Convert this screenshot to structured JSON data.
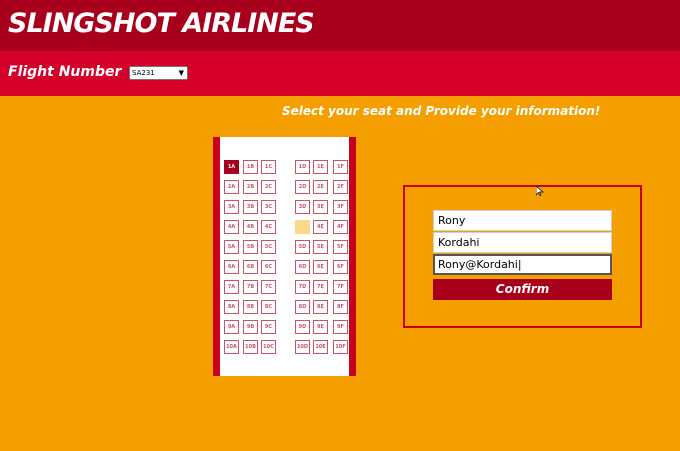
{
  "header": {
    "brand": "SLINGSHOT AIRLINES"
  },
  "flight": {
    "label": "Flight Number",
    "selected": "SA231"
  },
  "instructions": "Select your seat and Provide your information!",
  "seat_map": {
    "rows": [
      [
        "1A",
        "1B",
        "1C",
        "1D",
        "1E",
        "1F"
      ],
      [
        "2A",
        "2B",
        "2C",
        "2D",
        "2E",
        "2F"
      ],
      [
        "3A",
        "3B",
        "3C",
        "3D",
        "3E",
        "3F"
      ],
      [
        "4A",
        "4B",
        "4C",
        "4D",
        "4E",
        "4F"
      ],
      [
        "5A",
        "5B",
        "5C",
        "5D",
        "5E",
        "5F"
      ],
      [
        "6A",
        "6B",
        "6C",
        "6D",
        "6E",
        "6F"
      ],
      [
        "7A",
        "7B",
        "7C",
        "7D",
        "7E",
        "7F"
      ],
      [
        "8A",
        "8B",
        "8C",
        "8D",
        "8E",
        "8F"
      ],
      [
        "9A",
        "9B",
        "9C",
        "9D",
        "9E",
        "9F"
      ],
      [
        "10A",
        "10B",
        "10C",
        "10D",
        "10E",
        "10F"
      ]
    ],
    "selected_seat": "1A",
    "occupied_seats": [
      "4D"
    ]
  },
  "form": {
    "first_name": "Rony",
    "last_name": "Kordahi",
    "email": "Rony@Kordahi",
    "confirm_label": "Confirm"
  },
  "colors": {
    "background": "#f59e00",
    "header": "#a8001c",
    "subheader": "#d5002a",
    "accent": "#c8001c",
    "occupied": "#f9d98c"
  }
}
